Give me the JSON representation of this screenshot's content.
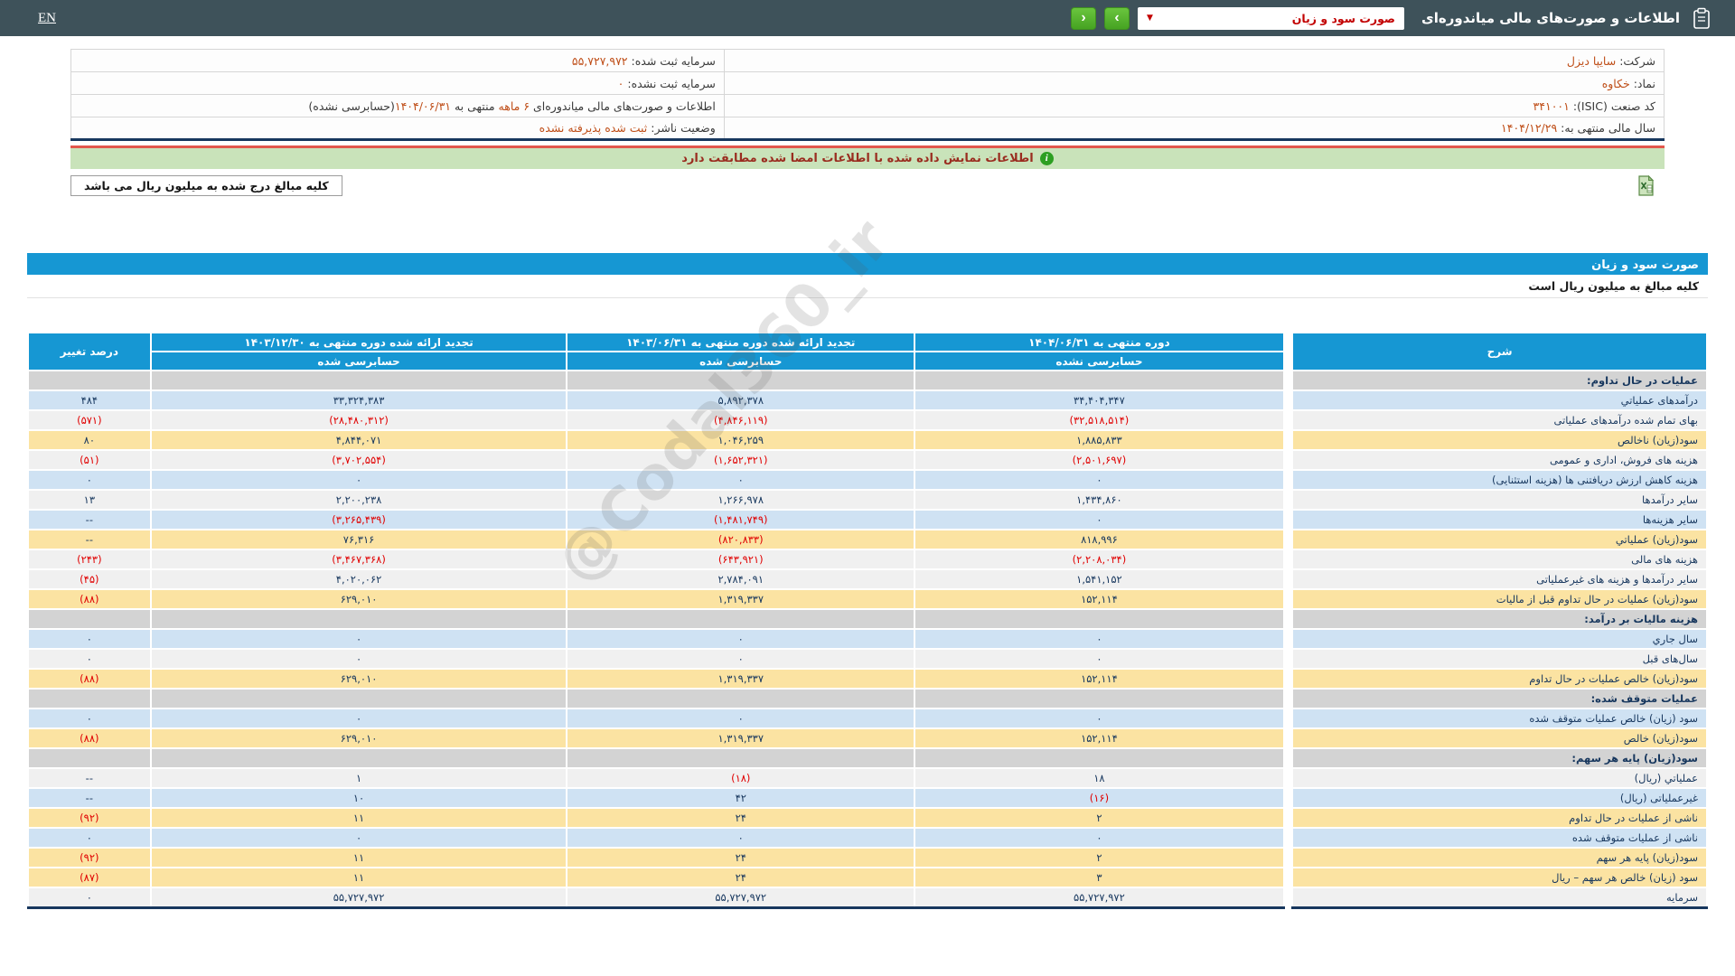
{
  "topbar": {
    "en_label": "EN",
    "title": "اطلاعات و صورت‌های مالی میاندوره‌ای",
    "period_select_value": "صورت سود و زیان",
    "select_caret": "▼",
    "nav_forward": "›",
    "nav_back": "‹"
  },
  "info": {
    "company_label": "شرکت:",
    "company_value": "سایپا دیزل",
    "registered_capital_label": "سرمایه ثبت شده:",
    "registered_capital_value": "۵۵,۷۲۷,۹۷۲",
    "symbol_label": "نماد:",
    "symbol_value": "خکاوه",
    "unregistered_capital_label": "سرمایه ثبت نشده:",
    "unregistered_capital_value": "۰",
    "isic_label": "کد صنعت (ISIC):",
    "isic_value": "۳۴۱۰۰۱",
    "period_text1": "اطلاعات و صورت‌های مالی میاندوره‌ای ",
    "period_highlight": "۶ ماهه",
    "period_text2": " منتهی به ",
    "period_date": "۱۴۰۴/۰۶/۳۱",
    "period_text3": "(حسابرسی نشده)",
    "fiscal_year_label": "سال مالی منتهی به:",
    "fiscal_year_value": "۱۴۰۴/۱۲/۲۹",
    "issuer_status_label": "وضعیت ناشر:",
    "issuer_status_value": "ثبت شده پذیرفته نشده"
  },
  "banner": {
    "text": "اطلاعات نمایش داده شده با اطلاعات امضا شده مطابقت دارد",
    "icon_glyph": "i"
  },
  "amounts_note": "کلیه مبالغ درج شده به میلیون ریال می باشد",
  "statement": {
    "title": "صورت سود و زیان",
    "unit_note": "کلیه مبالغ به میلیون ریال است",
    "watermark": "@Codal360_ir"
  },
  "table": {
    "desc_header": "شرح",
    "pct_header": "درصد تغییر",
    "periods": [
      {
        "title": "دوره منتهی به ۱۴۰۴/۰۶/۳۱",
        "audit": "حسابرسی نشده"
      },
      {
        "title": "تجدید ارائه شده دوره منتهی به ۱۴۰۳/۰۶/۳۱",
        "audit": "حسابرسی شده"
      },
      {
        "title": "تجدید ارائه شده دوره منتهی به ۱۴۰۳/۱۲/۳۰",
        "audit": "حسابرسی شده"
      }
    ],
    "rows": [
      {
        "label": "عملیات در حال تداوم:",
        "type": "section"
      },
      {
        "label": "درآمدهای عملیاتي",
        "type": "data",
        "bg": "blue",
        "values": [
          "۳۴,۴۰۴,۳۴۷",
          "۵,۸۹۲,۳۷۸",
          "۳۳,۳۲۴,۳۸۳",
          "۴۸۴"
        ]
      },
      {
        "label": "بهای تمام شده درآمدهای عملیاتی",
        "type": "data",
        "bg": "white",
        "values": [
          "(۳۲,۵۱۸,۵۱۴)",
          "(۴,۸۴۶,۱۱۹)",
          "(۲۸,۴۸۰,۳۱۲)",
          "(۵۷۱)"
        ]
      },
      {
        "label": "سود(زیان) ناخالص",
        "type": "data",
        "bg": "yellow",
        "values": [
          "۱,۸۸۵,۸۳۳",
          "۱,۰۴۶,۲۵۹",
          "۴,۸۴۴,۰۷۱",
          "۸۰"
        ]
      },
      {
        "label": "هزینه های فروش، اداری و عمومی",
        "type": "data",
        "bg": "white",
        "values": [
          "(۲,۵۰۱,۶۹۷)",
          "(۱,۶۵۲,۳۲۱)",
          "(۳,۷۰۲,۵۵۴)",
          "(۵۱)"
        ]
      },
      {
        "label": "هزینه کاهش ارزش دریافتنی ها (هزینه استثنایی)",
        "type": "data",
        "bg": "blue",
        "values": [
          "۰",
          "۰",
          "۰",
          "۰"
        ]
      },
      {
        "label": "سایر درآمدها",
        "type": "data",
        "bg": "white",
        "values": [
          "۱,۴۳۴,۸۶۰",
          "۱,۲۶۶,۹۷۸",
          "۲,۲۰۰,۲۳۸",
          "۱۳"
        ]
      },
      {
        "label": "سایر هزینه‌ها",
        "type": "data",
        "bg": "blue",
        "values": [
          "۰",
          "(۱,۴۸۱,۷۴۹)",
          "(۳,۲۶۵,۴۳۹)",
          "--"
        ]
      },
      {
        "label": "سود(زیان) عملیاتي",
        "type": "data",
        "bg": "yellow",
        "values": [
          "۸۱۸,۹۹۶",
          "(۸۲۰,۸۳۳)",
          "۷۶,۳۱۶",
          "--"
        ]
      },
      {
        "label": "هزینه های مالی",
        "type": "data",
        "bg": "white",
        "values": [
          "(۲,۲۰۸,۰۳۴)",
          "(۶۴۳,۹۲۱)",
          "(۳,۴۶۷,۳۶۸)",
          "(۲۴۳)"
        ]
      },
      {
        "label": "سایر درآمدها و هزینه های غیرعملیاتی",
        "type": "data",
        "bg": "white",
        "values": [
          "۱,۵۴۱,۱۵۲",
          "۲,۷۸۴,۰۹۱",
          "۴,۰۲۰,۰۶۲",
          "(۴۵)"
        ]
      },
      {
        "label": "سود(زیان) عملیات در حال تداوم قبل از مالیات",
        "type": "data",
        "bg": "yellow",
        "values": [
          "۱۵۲,۱۱۴",
          "۱,۳۱۹,۳۳۷",
          "۶۲۹,۰۱۰",
          "(۸۸)"
        ]
      },
      {
        "label": "هزینه مالیات بر درآمد:",
        "type": "section"
      },
      {
        "label": "سال جاري",
        "type": "data",
        "bg": "blue",
        "values": [
          "۰",
          "۰",
          "۰",
          "۰"
        ]
      },
      {
        "label": "سال‌های قبل",
        "type": "data",
        "bg": "white",
        "values": [
          "۰",
          "۰",
          "۰",
          "۰"
        ]
      },
      {
        "label": "سود(زیان) خالص عملیات در حال تداوم",
        "type": "data",
        "bg": "yellow",
        "values": [
          "۱۵۲,۱۱۴",
          "۱,۳۱۹,۳۳۷",
          "۶۲۹,۰۱۰",
          "(۸۸)"
        ]
      },
      {
        "label": "عملیات متوقف شده:",
        "type": "section"
      },
      {
        "label": "سود (زیان) خالص عملیات متوقف شده",
        "type": "data",
        "bg": "blue",
        "values": [
          "۰",
          "۰",
          "۰",
          "۰"
        ]
      },
      {
        "label": "سود(زیان) خالص",
        "type": "data",
        "bg": "yellow",
        "values": [
          "۱۵۲,۱۱۴",
          "۱,۳۱۹,۳۳۷",
          "۶۲۹,۰۱۰",
          "(۸۸)"
        ]
      },
      {
        "label": "سود(زیان) پایه هر سهم:",
        "type": "section"
      },
      {
        "label": "عملیاتي (ریال)",
        "type": "data",
        "bg": "white",
        "values": [
          "۱۸",
          "(۱۸)",
          "۱",
          "--"
        ]
      },
      {
        "label": "غیرعملیاتی (ریال)",
        "type": "data",
        "bg": "blue",
        "values": [
          "(۱۶)",
          "۴۲",
          "۱۰",
          "--"
        ]
      },
      {
        "label": "ناشی از عملیات در حال تداوم",
        "type": "data",
        "bg": "yellow",
        "values": [
          "۲",
          "۲۴",
          "۱۱",
          "(۹۲)"
        ]
      },
      {
        "label": "ناشی از عملیات متوقف شده",
        "type": "data",
        "bg": "blue",
        "values": [
          "۰",
          "۰",
          "۰",
          "۰"
        ]
      },
      {
        "label": "سود(زیان) پایه هر سهم",
        "type": "data",
        "bg": "yellow",
        "values": [
          "۲",
          "۲۴",
          "۱۱",
          "(۹۲)"
        ]
      },
      {
        "label": "سود (زیان) خالص هر سهم – ریال",
        "type": "data",
        "bg": "yellow",
        "values": [
          "۳",
          "۲۴",
          "۱۱",
          "(۸۷)"
        ]
      },
      {
        "label": "سرمایه",
        "type": "data",
        "bg": "white",
        "values": [
          "۵۵,۷۲۷,۹۷۲",
          "۵۵,۷۲۷,۹۷۲",
          "۵۵,۷۲۷,۹۷۲",
          "۰"
        ]
      }
    ]
  }
}
